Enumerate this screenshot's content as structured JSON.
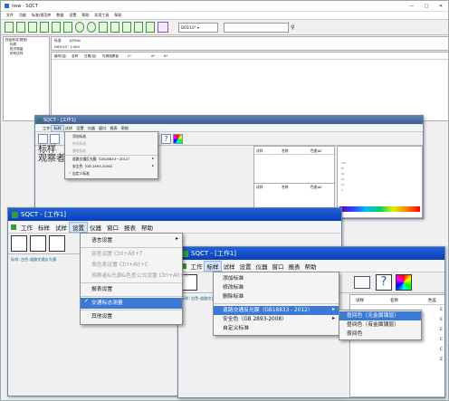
{
  "bg_window": {
    "title": "new - SQCT",
    "controls": [
      "—",
      "□",
      "✕"
    ],
    "menus": [
      "文件",
      "功能",
      "标准/规范库",
      "数据",
      "设置",
      "帮助",
      "实用工具",
      "帮助"
    ],
    "combo_value": "D65/10° ▾",
    "search_placeholder": "",
    "tree": [
      "样品测试(视觉)",
      "标样",
      "批次测量",
      "所有试样"
    ],
    "std_label": "标准",
    "std_value": "JiZVsb",
    "std2_label": "D65/10°",
    "std2_value": "1.000",
    "list_headers": [
      "编号(结)",
      "名称",
      "日期(结)",
      "光源观察者",
      "L*",
      "a*",
      "b*"
    ]
  },
  "win2": {
    "title": "SQCT - [工作1]",
    "menus": [
      "工作",
      "标样",
      "试样",
      "设置",
      "仪器",
      "窗口",
      "报表",
      "帮助"
    ],
    "big_text": [
      "标样",
      "观察者"
    ],
    "submenu": [
      {
        "label": "添加标准",
        "dis": false
      },
      {
        "label": "修改标准",
        "dis": true
      },
      {
        "label": "删除标准",
        "dis": true
      },
      {
        "label": "道路交通反光膜（GB18833－2012）",
        "dis": false,
        "arrow": "▸"
      },
      {
        "label": "安全色（GB 2893-2008）",
        "dis": false,
        "arrow": "▸"
      },
      {
        "label": "自定义标准",
        "dis": false,
        "check": "✓"
      }
    ],
    "right_headers": [
      "试样",
      "名称",
      "色差ΔE"
    ],
    "right_headers2": [
      "试样",
      "名称",
      "色差ΔE"
    ],
    "chart_ticks": [
      "100",
      "80",
      "60",
      "40",
      "20",
      "0"
    ]
  },
  "win3": {
    "title": "SQCT - [工作1]",
    "menus": [
      "工作",
      "标样",
      "试样",
      "设置",
      "仪器",
      "窗口",
      "报表",
      "帮助"
    ],
    "status_text": "标样: 白色·道路交通反光膜",
    "menu_items": [
      {
        "label": "语言设置",
        "arrow": "▸"
      },
      {
        "sep": true
      },
      {
        "label": "容差设置  Ctrl+Alt+T",
        "dis": true
      },
      {
        "label": "表色系设置  Ctrl+Alt+C",
        "dis": true
      },
      {
        "label": "观察者&光源&色差公式设置  Ctrl+Alt+O",
        "dis": true
      },
      {
        "sep": true
      },
      {
        "label": "报表设置"
      },
      {
        "sep": true
      },
      {
        "label": "交通标志测量",
        "check": "✓",
        "sel": true
      },
      {
        "sep": true
      },
      {
        "label": "其他设置"
      }
    ]
  },
  "win4": {
    "title": "SQCT - [工作1]",
    "menus": [
      "工作",
      "标样",
      "试样",
      "设置",
      "仪器",
      "窗口",
      "报表",
      "帮助"
    ],
    "status_text": "标样: 白色·道路交通反光膜",
    "menu_items": [
      {
        "label": "添加标准"
      },
      {
        "label": "修改标准"
      },
      {
        "label": "删除标准"
      },
      {
        "sep": true
      },
      {
        "label": "道路交通反光膜（GB18833 - 2012）",
        "arrow": "▸",
        "sel": true
      },
      {
        "label": "安全色（GB 2893-2008）",
        "arrow": "▸"
      },
      {
        "label": "自定义标准"
      }
    ],
    "submenu": [
      {
        "label": "昼间色（无金属镀层）",
        "sel": true
      },
      {
        "label": "昼间色（有金属镀层）"
      },
      {
        "label": "夜间色"
      }
    ],
    "right_headers": [
      "试样",
      "名称",
      "色差"
    ],
    "right_rows": [
      "E",
      "E",
      "E",
      "C",
      "C",
      "Z"
    ]
  }
}
